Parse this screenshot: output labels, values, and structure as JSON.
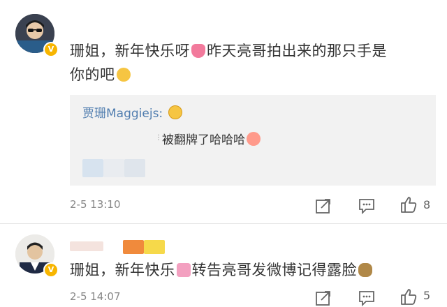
{
  "comments": [
    {
      "text_part1": "珊姐，新年快乐呀",
      "text_part2": "昨天亮哥拍出来的那只手是",
      "text_part3": "你的吧",
      "emoji1": "heart-emoji",
      "emoji2": "thinking-emoji",
      "reply": {
        "author": "贾珊Maggiejs:",
        "author_emoji": "grin-emoji",
        "text": "被翻牌了哈哈哈",
        "text_emoji": "pig-emoji"
      },
      "timestamp": "2-5 13:10",
      "actions": {
        "share_icon": "share-icon",
        "comment_icon": "comment-icon",
        "like_icon": "thumbs-up-icon",
        "like_count": "8"
      }
    },
    {
      "text_part1": "珊姐，新年快乐",
      "text_part2": "转告亮哥发微博记得露脸",
      "emoji1": "gift-emoji",
      "emoji2": "dog-emoji",
      "timestamp": "2-5 14:07",
      "actions": {
        "share_icon": "share-icon",
        "comment_icon": "comment-icon",
        "like_icon": "thumbs-up-icon",
        "like_count": "5"
      }
    }
  ],
  "badge_label": "V",
  "colors": {
    "link_blue": "#507daf",
    "reply_bg": "#f2f2f2",
    "verified_gold": "#f7b500",
    "meta_gray": "#888888"
  }
}
